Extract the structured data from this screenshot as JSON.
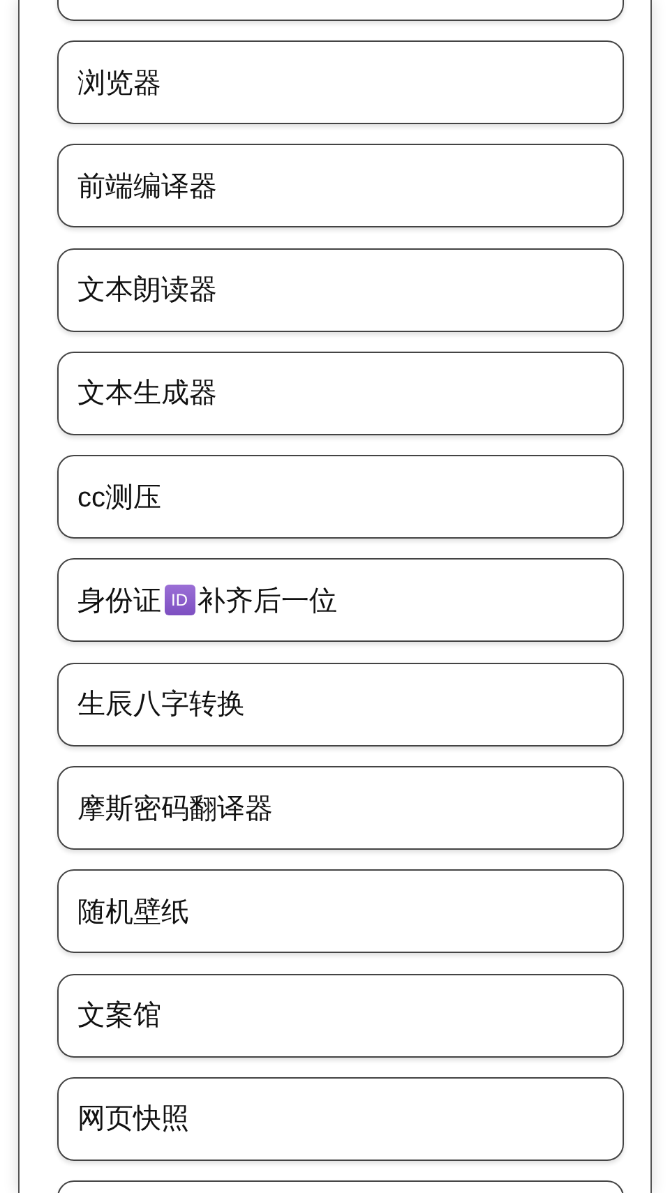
{
  "items": [
    {
      "kind": "blank"
    },
    {
      "kind": "text",
      "parts": [
        {
          "kind": "text",
          "text": "浏览器"
        }
      ]
    },
    {
      "kind": "text",
      "parts": [
        {
          "kind": "text",
          "text": "前端编译器"
        }
      ]
    },
    {
      "kind": "text",
      "parts": [
        {
          "kind": "text",
          "text": "文本朗读器"
        }
      ]
    },
    {
      "kind": "text",
      "parts": [
        {
          "kind": "text",
          "text": "文本生成器"
        }
      ]
    },
    {
      "kind": "text",
      "parts": [
        {
          "kind": "text",
          "text": "cc测压"
        }
      ]
    },
    {
      "kind": "text",
      "parts": [
        {
          "kind": "text",
          "text": "身份证"
        },
        {
          "kind": "badge",
          "text": "ID"
        },
        {
          "kind": "text",
          "text": "补齐后一位"
        }
      ]
    },
    {
      "kind": "text",
      "parts": [
        {
          "kind": "text",
          "text": "生辰八字转换"
        }
      ]
    },
    {
      "kind": "text",
      "parts": [
        {
          "kind": "text",
          "text": "摩斯密码翻译器"
        }
      ]
    },
    {
      "kind": "text",
      "parts": [
        {
          "kind": "text",
          "text": "随机壁纸"
        }
      ]
    },
    {
      "kind": "text",
      "parts": [
        {
          "kind": "text",
          "text": "文案馆"
        }
      ]
    },
    {
      "kind": "text",
      "parts": [
        {
          "kind": "text",
          "text": "网页快照"
        }
      ]
    },
    {
      "kind": "blank"
    }
  ]
}
